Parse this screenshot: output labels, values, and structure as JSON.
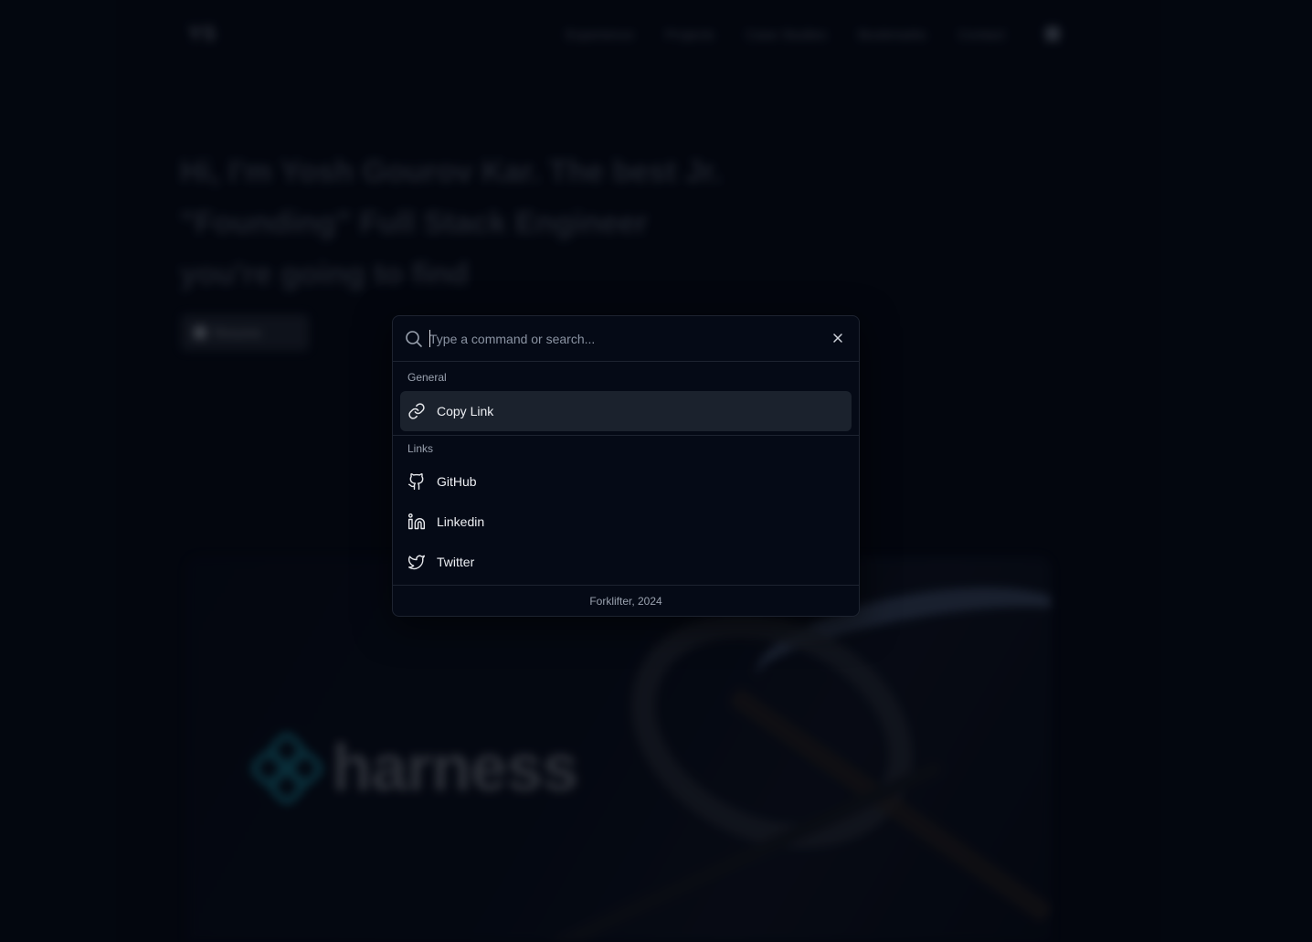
{
  "background": {
    "logo": "YS",
    "nav_links": [
      "Experience",
      "Projects",
      "Case Studies",
      "Bookmarks",
      "Contact"
    ],
    "hero_lines": [
      "Hi, I'm Yosh Gourov Kar. The best Jr.",
      "\"Founding\" Full Stack Engineer",
      "you're going to find"
    ],
    "resume_label": "Resume",
    "feature_brand": "harness"
  },
  "palette": {
    "search": {
      "placeholder": "Type a command or search...",
      "value": ""
    },
    "groups": [
      {
        "label": "General",
        "items": [
          {
            "label": "Copy Link",
            "icon": "link-icon",
            "active": true
          }
        ]
      },
      {
        "label": "Links",
        "items": [
          {
            "label": "GitHub",
            "icon": "github-icon",
            "active": false
          },
          {
            "label": "Linkedin",
            "icon": "linkedin-icon",
            "active": false
          },
          {
            "label": "Twitter",
            "icon": "twitter-icon",
            "active": false
          }
        ]
      }
    ],
    "footer": "Forklifter, 2024"
  },
  "colors": {
    "page_bg": "#040812",
    "palette_bg": "#050a16",
    "border": "#1d2330",
    "active_item_bg": "#1b222d",
    "muted_text": "#9aa2af",
    "brand_teal": "#1b8fa3"
  }
}
